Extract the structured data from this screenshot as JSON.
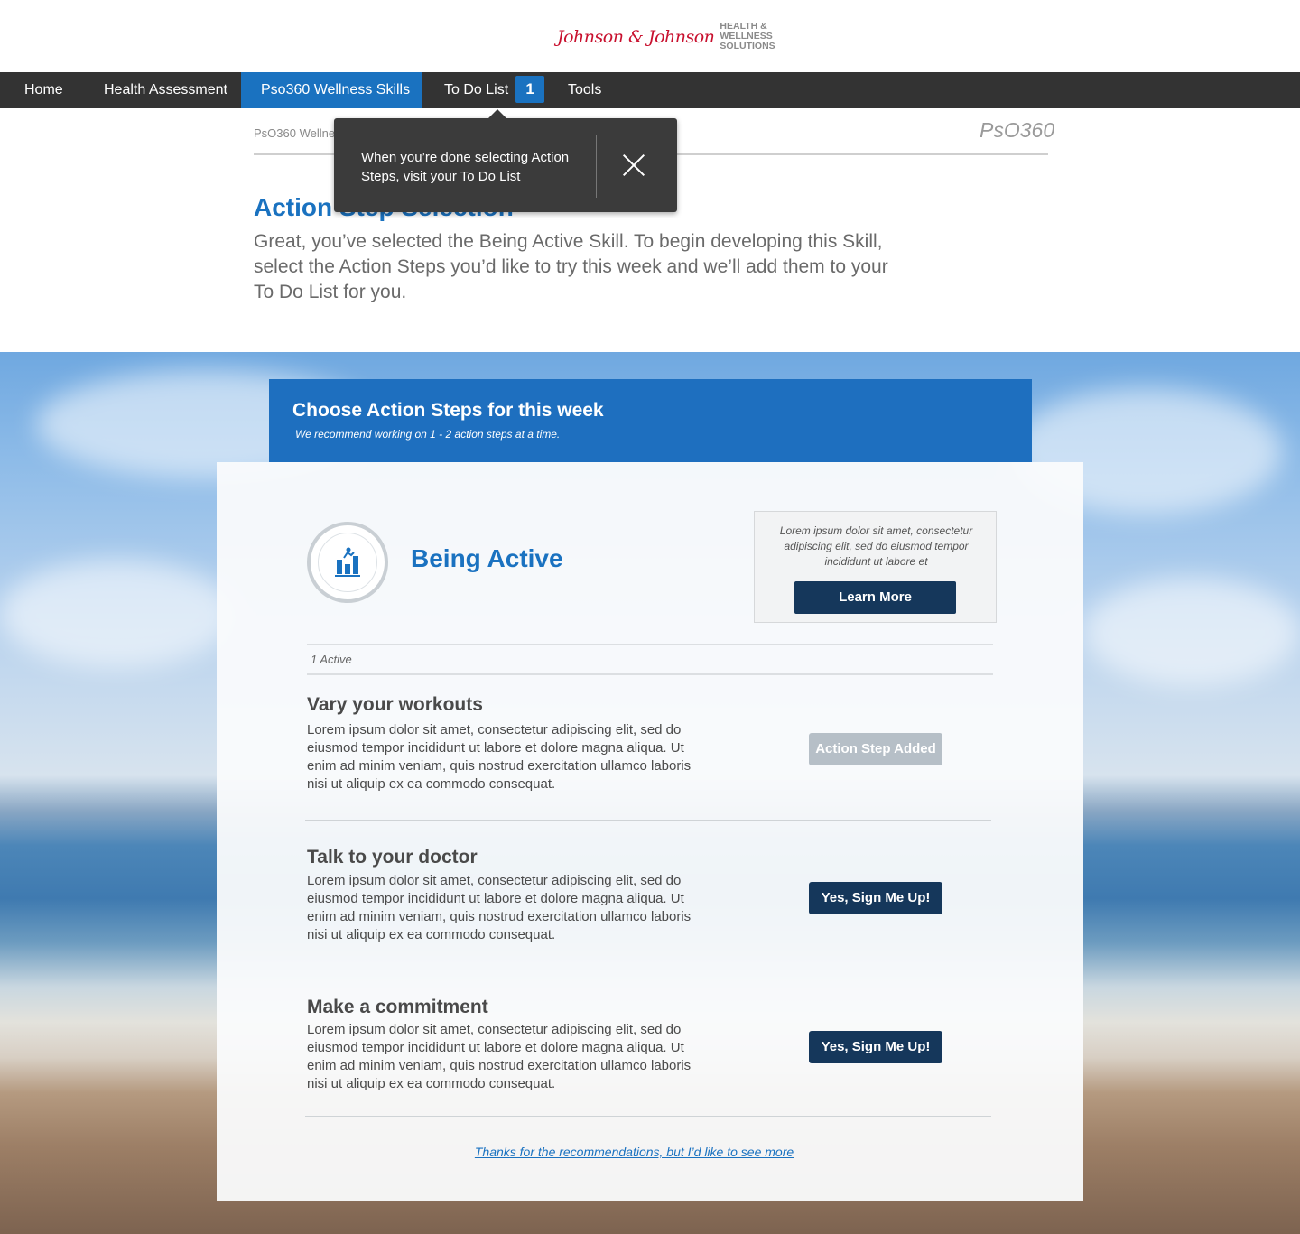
{
  "header": {
    "logo_script": "Johnson & Johnson",
    "logo_line1": "HEALTH &",
    "logo_line2": "WELLNESS",
    "logo_line3": "SOLUTIONS"
  },
  "nav": {
    "items": [
      {
        "label": "Home"
      },
      {
        "label": "Health Assessment"
      },
      {
        "label": "Pso360 Wellness Skills"
      },
      {
        "label": "To Do List",
        "badge": "1"
      },
      {
        "label": "Tools"
      }
    ],
    "active_index": 2
  },
  "breadcrumb": "PsO360 Wellness Skills > Choose a Skill > Being Active: Choose Action Steps",
  "brand_right": "PsO360",
  "tooltip": {
    "text": "When you’re done selecting Action Steps, visit your To Do List"
  },
  "page": {
    "title": "Action Step Selection",
    "intro": "Great, you’ve selected the Being Active Skill.  To begin developing this Skill, select the Action Steps you’d like to try this week and we’ll add them to your To Do List for you."
  },
  "card_header": {
    "title": "Choose Action Steps for this week",
    "subtitle": "We recommend working on 1 - 2 action steps at a time."
  },
  "skill": {
    "name": "Being Active",
    "icon": "activity-chart-icon",
    "info_text": "Lorem ipsum dolor sit amet, consectetur adipiscing elit, sed do eiusmod tempor incididunt ut labore et",
    "learn_more_label": "Learn More",
    "active_count_label": "1 Active"
  },
  "steps": [
    {
      "title": "Vary your workouts",
      "description": "Lorem ipsum dolor sit amet, consectetur adipiscing elit, sed do eiusmod tempor incididunt ut labore et dolore magna aliqua. Ut enim ad minim veniam, quis nostrud exercitation ullamco laboris nisi ut aliquip ex ea commodo consequat.",
      "button_label": "Action Step Added",
      "added": true
    },
    {
      "title": "Talk to your doctor",
      "description": "Lorem ipsum dolor sit amet, consectetur adipiscing elit, sed do eiusmod tempor incididunt ut labore et dolore magna aliqua. Ut enim ad minim veniam, quis nostrud exercitation ullamco laboris nisi ut aliquip ex ea commodo consequat.",
      "button_label": "Yes, Sign Me Up!",
      "added": false
    },
    {
      "title": "Make a commitment",
      "description": "Lorem ipsum dolor sit amet, consectetur adipiscing elit, sed do eiusmod tempor incididunt ut labore et dolore magna aliqua. Ut enim ad minim veniam, quis nostrud exercitation ullamco laboris nisi ut aliquip ex ea commodo consequat.",
      "button_label": "Yes, Sign Me Up!",
      "added": false
    }
  ],
  "more_link": "Thanks for the recommendations, but I’d like to see more",
  "colors": {
    "primary_blue": "#1a72c0",
    "navy_button": "#15375b",
    "navbar": "#333333",
    "added_button": "#b6bfc7",
    "brand_red": "#c8102e"
  }
}
